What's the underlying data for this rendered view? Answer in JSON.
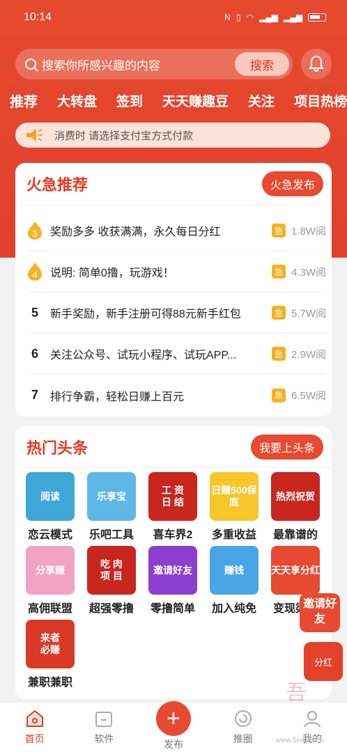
{
  "status": {
    "time": "10:14"
  },
  "search": {
    "placeholder": "搜索你所感兴趣的内容",
    "button": "搜索"
  },
  "tabs": [
    "推荐",
    "大转盘",
    "签到",
    "天天赚趣豆",
    "关注",
    "项目热榜"
  ],
  "notice": {
    "text": "消费时 请选择支付宝方式付款"
  },
  "hot": {
    "title": "火急推荐",
    "button": "火急发布",
    "items": [
      {
        "rank": "3",
        "title": "奖励多多 收获满满，永久每日分红",
        "tag": "急",
        "views": "1.8W阅"
      },
      {
        "rank": "4",
        "title": "说明: 简单0撸，玩游戏！",
        "tag": "急",
        "views": "4.3W阅"
      },
      {
        "rank": "5",
        "title": "新手奖励，新手注册可得88元新手红包",
        "tag": "急",
        "views": "5.7W阅"
      },
      {
        "rank": "6",
        "title": "关注公众号、试玩小程序、试玩APP...",
        "tag": "急",
        "views": "2.9W阅"
      },
      {
        "rank": "7",
        "title": "排行争霸，轻松日赚上百元",
        "tag": "急",
        "views": "6.5W阅"
      }
    ]
  },
  "headlines": {
    "title": "热门头条",
    "button": "我要上头条",
    "items": [
      {
        "label": "恋云模式",
        "thumb": "阅读",
        "color": "#3fa6d8"
      },
      {
        "label": "乐吧工具",
        "thumb": "乐享宝",
        "color": "#5fb7e8"
      },
      {
        "label": "喜车界2",
        "thumb": "工 资\n日 结",
        "color": "#c8261f"
      },
      {
        "label": "多重收益",
        "thumb": "日赚500保底",
        "color": "#f6c62a"
      },
      {
        "label": "最靠谱的",
        "thumb": "热烈祝贺",
        "color": "#c8261f"
      },
      {
        "label": "高佣联盟",
        "thumb": "分享赚",
        "color": "#f2a3c4"
      },
      {
        "label": "超强零撸",
        "thumb": "吃 肉\n项 目",
        "color": "#c8261f"
      },
      {
        "label": "零撸简单",
        "thumb": "邀请好友",
        "color": "#8a3fd0"
      },
      {
        "label": "加入纯免",
        "thumb": "赚钱",
        "color": "#4aa5e6"
      },
      {
        "label": "变现渠道",
        "thumb": "天天享分红",
        "color": "#e74a30"
      },
      {
        "label": "兼职兼职",
        "thumb": "来者\n必赚",
        "color": "#d93a25"
      }
    ]
  },
  "floats": {
    "invite": "邀请好友",
    "bonus": "分红"
  },
  "nav": [
    "首页",
    "软件",
    "发布",
    "推圈",
    "我的"
  ],
  "watermark": "www.5esmw.cn"
}
